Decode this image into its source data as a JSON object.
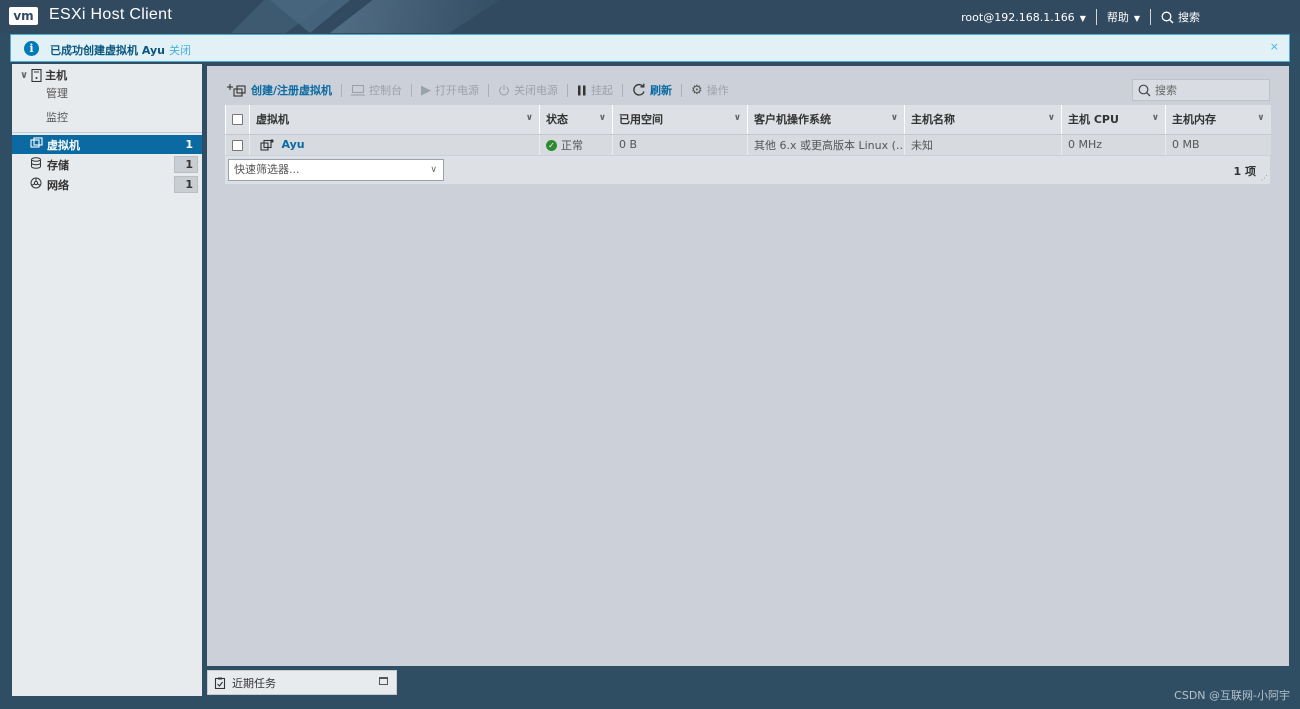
{
  "app": {
    "logo": "vm",
    "title": "ESXi Host Client"
  },
  "header": {
    "user": "root@192.168.1.166",
    "help": "帮助",
    "search": "搜索"
  },
  "notification": {
    "message": "已成功创建虚拟机 Ayu",
    "close_link": "关闭",
    "dismiss": "×"
  },
  "sidebar": {
    "host": "主机",
    "host_children": [
      "管理",
      "监控"
    ],
    "items": [
      {
        "label": "虚拟机",
        "count": "1",
        "active": true
      },
      {
        "label": "存储",
        "count": "1",
        "active": false
      },
      {
        "label": "网络",
        "count": "1",
        "active": false
      }
    ]
  },
  "toolbar": {
    "create": "创建/注册虚拟机",
    "console": "控制台",
    "power_on": "打开电源",
    "power_off": "关闭电源",
    "suspend": "挂起",
    "refresh": "刷新",
    "actions": "操作",
    "search_placeholder": "搜索"
  },
  "table": {
    "columns": [
      "虚拟机",
      "状态",
      "已用空间",
      "客户机操作系统",
      "主机名称",
      "主机 CPU",
      "主机内存"
    ],
    "rows": [
      {
        "name": "Ayu",
        "status": "正常",
        "used": "0 B",
        "os": "其他 6.x 或更高版本 Linux (…",
        "hostname": "未知",
        "cpu": "0 MHz",
        "mem": "0 MB"
      }
    ],
    "filter_placeholder": "快速筛选器...",
    "count": "1 项"
  },
  "tasks": {
    "label": "近期任务"
  },
  "watermark": "CSDN @互联网-小阿宇",
  "colors": {
    "accent": "#0a6aa1",
    "header": "#314a5f",
    "notif_border": "#49afd9",
    "ok": "#2f8a2f"
  }
}
